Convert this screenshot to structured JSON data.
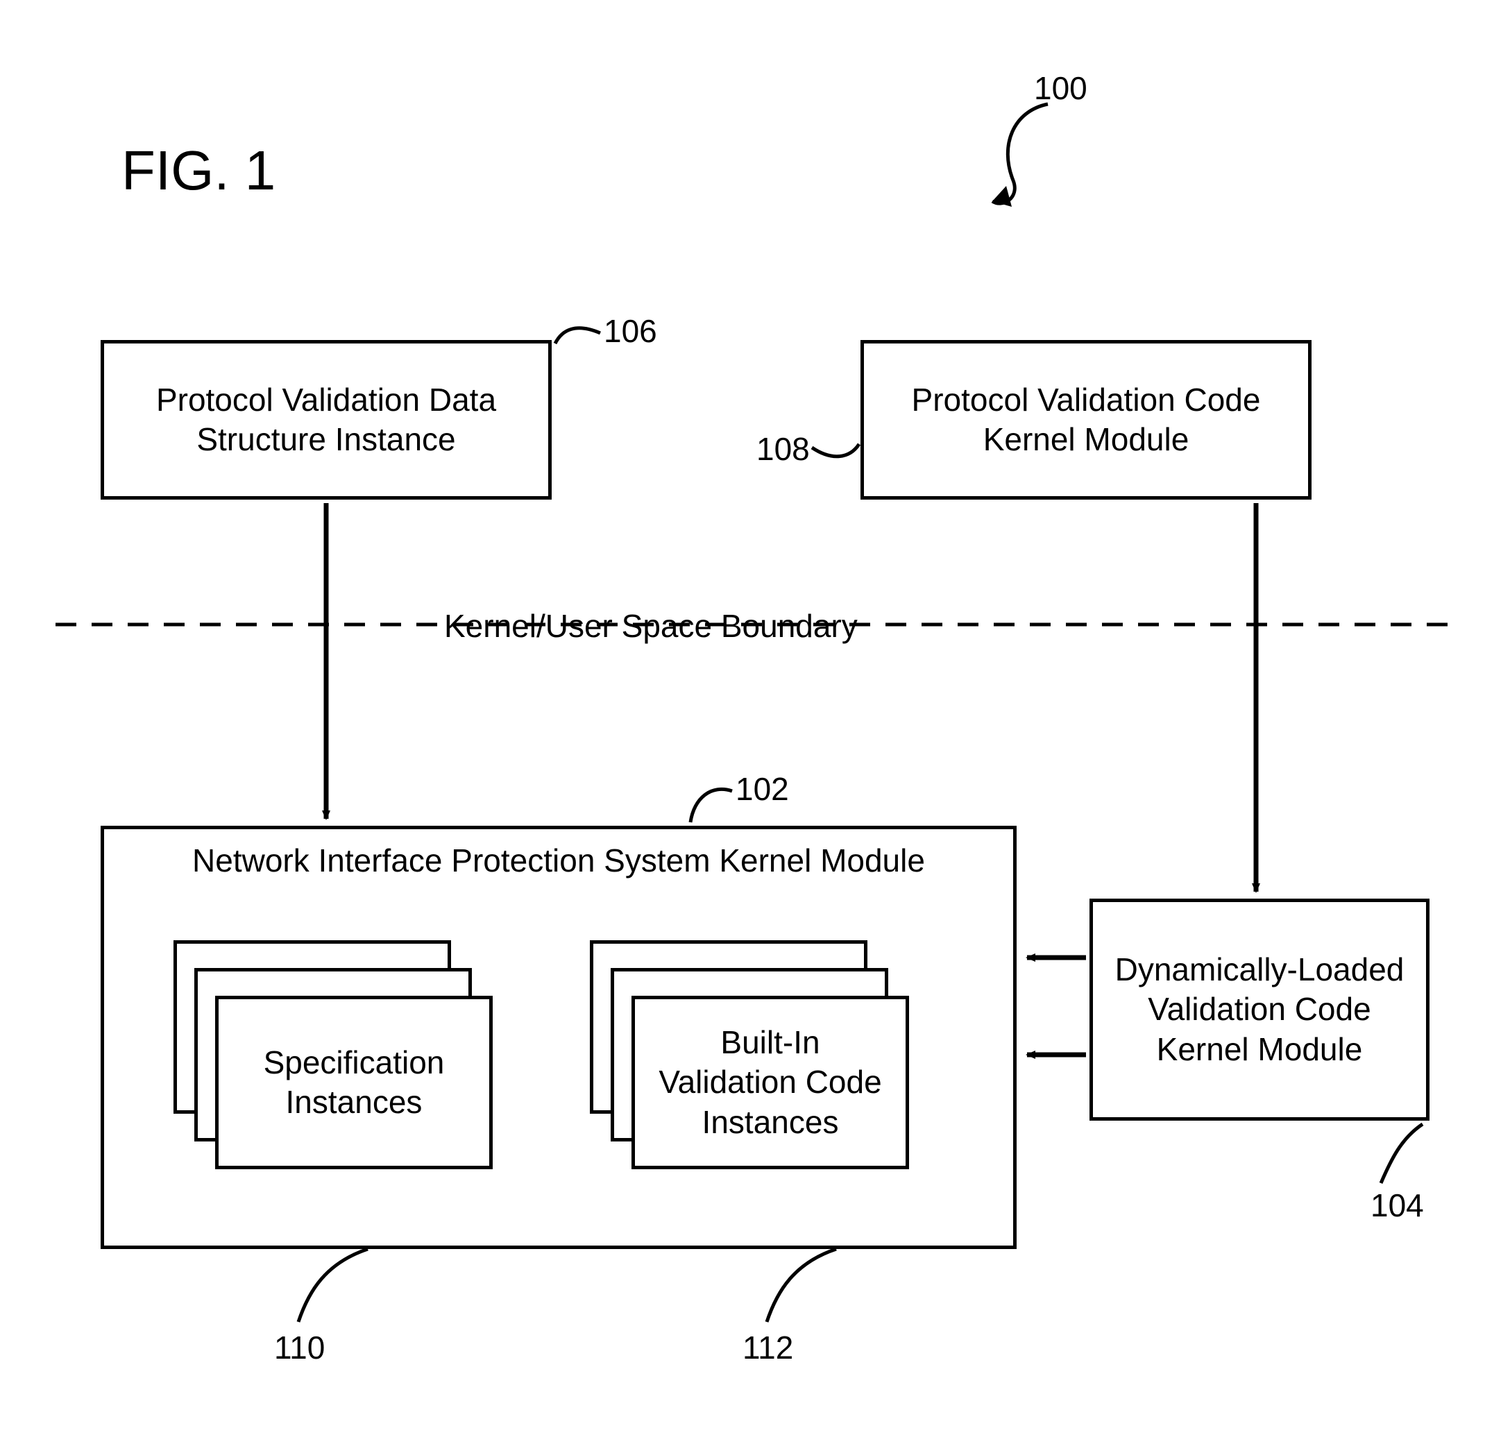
{
  "figure": {
    "title": "FIG. 1"
  },
  "refs": {
    "r100": "100",
    "r102": "102",
    "r104": "104",
    "r106": "106",
    "r108": "108",
    "r110": "110",
    "r112": "112"
  },
  "boundary": {
    "label": "Kernel/User Space Boundary"
  },
  "boxes": {
    "pvds": "Protocol Validation Data\nStructure Instance",
    "pvck": "Protocol Validation Code\nKernel Module",
    "nips": "Network Interface Protection System Kernel Module",
    "spec": "Specification\nInstances",
    "builtin": "Built-In\nValidation Code\nInstances",
    "dyn": "Dynamically-Loaded\nValidation Code\nKernel Module"
  }
}
